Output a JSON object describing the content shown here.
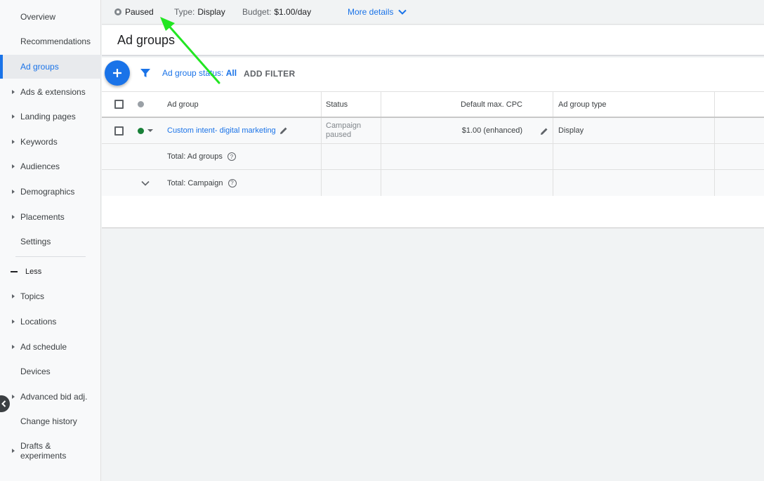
{
  "sidebar": {
    "items": [
      {
        "label": "Overview",
        "caret": false
      },
      {
        "label": "Recommendations",
        "caret": false
      },
      {
        "label": "Ad groups",
        "caret": false,
        "active": true
      },
      {
        "label": "Ads & extensions",
        "caret": true
      },
      {
        "label": "Landing pages",
        "caret": true
      },
      {
        "label": "Keywords",
        "caret": true
      },
      {
        "label": "Audiences",
        "caret": true
      },
      {
        "label": "Demographics",
        "caret": true
      },
      {
        "label": "Placements",
        "caret": true
      },
      {
        "label": "Settings",
        "caret": false
      }
    ],
    "less_label": "Less",
    "more_items": [
      {
        "label": "Topics",
        "caret": true
      },
      {
        "label": "Locations",
        "caret": true
      },
      {
        "label": "Ad schedule",
        "caret": true
      },
      {
        "label": "Devices",
        "caret": false
      },
      {
        "label": "Advanced bid adj.",
        "caret": true
      },
      {
        "label": "Change history",
        "caret": false
      },
      {
        "label": "Drafts & experiments",
        "caret": true
      }
    ]
  },
  "topbar": {
    "status": "Paused",
    "type_label": "Type:",
    "type_value": "Display",
    "budget_label": "Budget:",
    "budget_value": "$1.00/day",
    "more_details": "More details"
  },
  "page_title": "Ad groups",
  "toolbar": {
    "filter_label": "Ad group status:",
    "filter_value": "All",
    "add_filter": "ADD FILTER"
  },
  "table": {
    "headers": {
      "ad_group": "Ad group",
      "status": "Status",
      "default_max_cpc": "Default max. CPC",
      "ad_group_type": "Ad group type"
    },
    "rows": [
      {
        "ad_group": "Custom intent- digital marketing",
        "status_line1": "Campaign",
        "status_line2": "paused",
        "default_max_cpc": "$1.00 (enhanced)",
        "ad_group_type": "Display"
      }
    ],
    "total_ad_groups": "Total: Ad groups",
    "total_campaign": "Total: Campaign"
  },
  "colors": {
    "accent": "#1a73e8",
    "enabled_green": "#188038",
    "annotation_arrow": "#22e622"
  }
}
